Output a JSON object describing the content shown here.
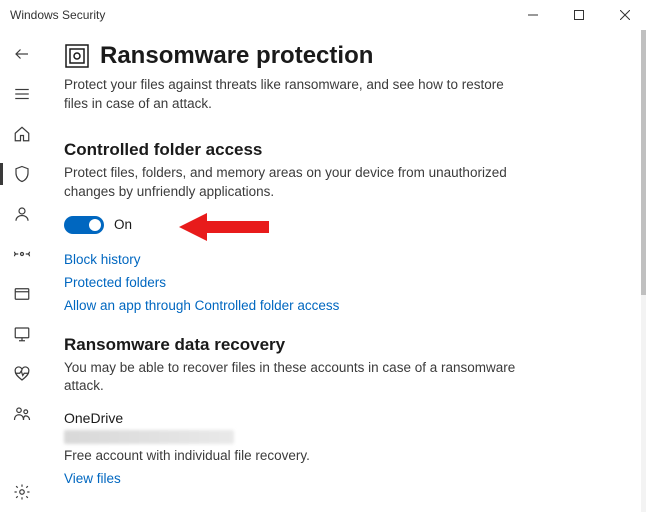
{
  "window": {
    "title": "Windows Security"
  },
  "page": {
    "title": "Ransomware protection",
    "description": "Protect your files against threats like ransomware, and see how to restore files in case of an attack."
  },
  "cfa": {
    "title": "Controlled folder access",
    "description": "Protect files, folders, and memory areas on your device from unauthorized changes by unfriendly applications.",
    "toggle_state": "On",
    "links": {
      "block_history": "Block history",
      "protected_folders": "Protected folders",
      "allow_app": "Allow an app through Controlled folder access"
    }
  },
  "recovery": {
    "title": "Ransomware data recovery",
    "description": "You may be able to recover files in these accounts in case of a ransomware attack.",
    "provider": "OneDrive",
    "provider_desc": "Free account with individual file recovery.",
    "view_files": "View files"
  }
}
